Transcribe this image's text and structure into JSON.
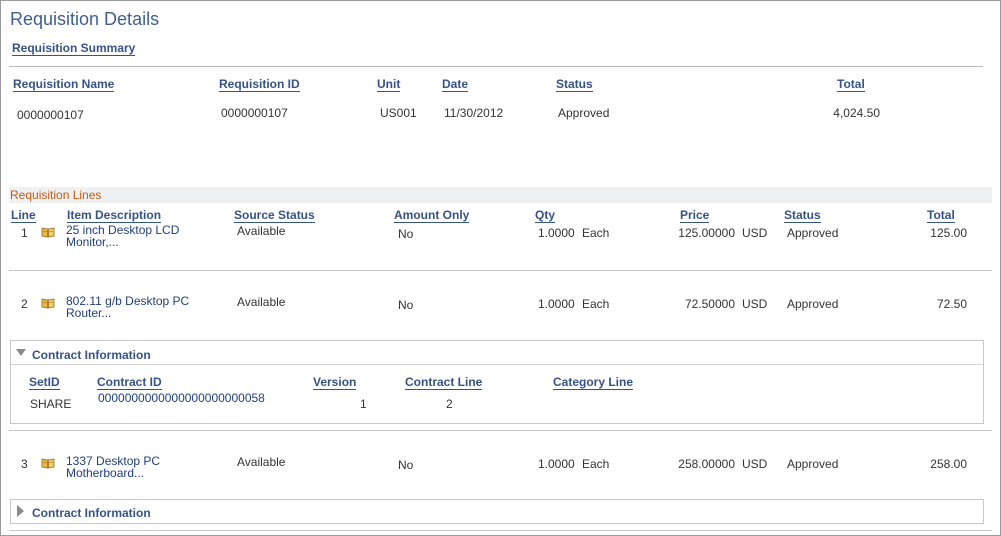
{
  "page": {
    "title": "Requisition Details"
  },
  "summary": {
    "title": "Requisition Summary",
    "headers": {
      "name": "Requisition Name",
      "id": "Requisition ID",
      "unit": "Unit",
      "date": "Date",
      "status": "Status",
      "total": "Total"
    },
    "row": {
      "name": "0000000107",
      "id": "0000000107",
      "unit": "US001",
      "date": "11/30/2012",
      "status": "Approved",
      "total": "4,024.50"
    }
  },
  "lines": {
    "title": "Requisition Lines",
    "headers": {
      "line": "Line",
      "item": "Item Description",
      "source_status": "Source Status",
      "amount_only": "Amount Only",
      "qty": "Qty",
      "price": "Price",
      "status": "Status",
      "total": "Total"
    },
    "rows": [
      {
        "line": "1",
        "item_1": "25 inch Desktop LCD",
        "item_2": "Monitor,...",
        "source_status": "Available",
        "amount_only": "No",
        "qty": "1.0000",
        "uom": "Each",
        "price": "125.00000",
        "currency": "USD",
        "status": "Approved",
        "total": "125.00"
      },
      {
        "line": "2",
        "item_1": "802.11 g/b Desktop PC",
        "item_2": "Router...",
        "source_status": "Available",
        "amount_only": "No",
        "qty": "1.0000",
        "uom": "Each",
        "price": "72.50000",
        "currency": "USD",
        "status": "Approved",
        "total": "72.50"
      },
      {
        "line": "3",
        "item_1": "1337 Desktop PC",
        "item_2": "Motherboard...",
        "source_status": "Available",
        "amount_only": "No",
        "qty": "1.0000",
        "uom": "Each",
        "price": "258.00000",
        "currency": "USD",
        "status": "Approved",
        "total": "258.00"
      }
    ]
  },
  "contract": {
    "title": "Contract Information",
    "headers": {
      "setid": "SetID",
      "contract_id": "Contract ID",
      "version": "Version",
      "contract_line": "Contract Line",
      "category_line": "Category Line"
    },
    "row": {
      "setid": "SHARE",
      "contract_id": "0000000000000000000000058",
      "version": "1",
      "contract_line": "2",
      "category_line": ""
    },
    "collapsed_title": "Contract Information"
  },
  "icons": {
    "item_icon": "book-icon",
    "expand_open": "triangle-down-icon",
    "expand_closed": "triangle-right-icon"
  },
  "colors": {
    "heading": "#355387",
    "section_label": "#c35a11",
    "link": "#1f3f7a"
  }
}
